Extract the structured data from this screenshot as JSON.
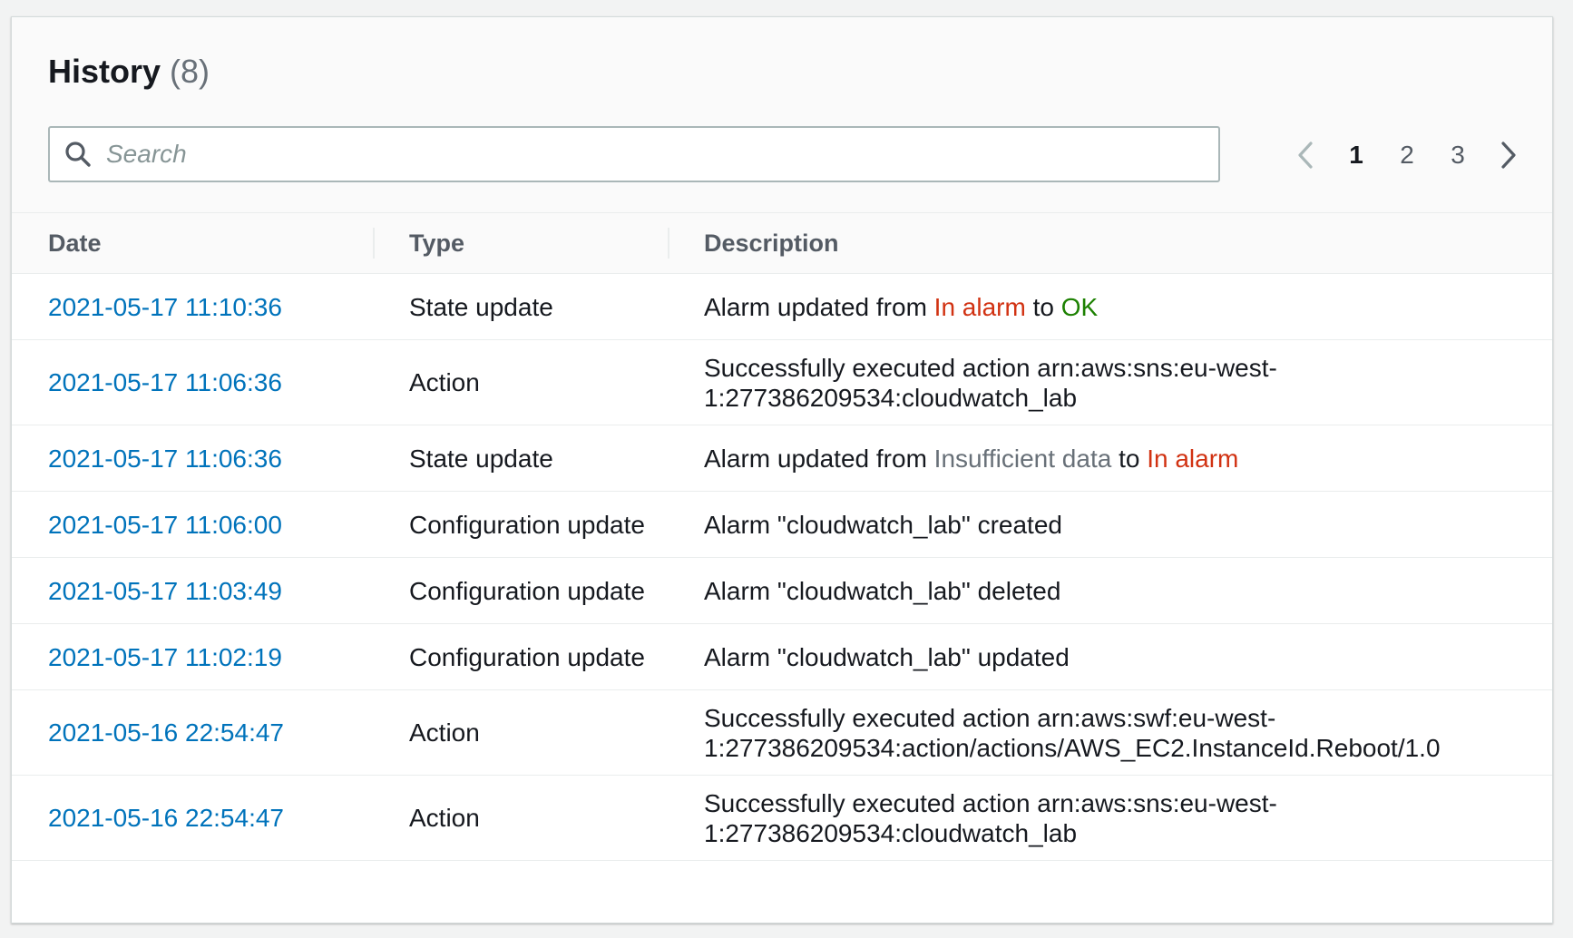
{
  "header": {
    "title": "History",
    "count": "(8)"
  },
  "search": {
    "placeholder": "Search",
    "value": ""
  },
  "pagination": {
    "pages": [
      "1",
      "2",
      "3"
    ],
    "current": "1"
  },
  "table": {
    "columns": [
      "Date",
      "Type",
      "Description"
    ],
    "rows": [
      {
        "date": "2021-05-17 11:10:36",
        "type": "State update",
        "desc_prefix": "Alarm updated from ",
        "from_state": "In alarm",
        "mid": " to ",
        "to_state": "OK"
      },
      {
        "date": "2021-05-17 11:06:36",
        "type": "Action",
        "desc_line1": "Successfully executed action arn:aws:sns:eu-west-",
        "desc_line2": "1:277386209534:cloudwatch_lab"
      },
      {
        "date": "2021-05-17 11:06:36",
        "type": "State update",
        "desc_prefix": "Alarm updated from ",
        "from_state": "Insufficient data",
        "mid": " to ",
        "to_state": "In alarm"
      },
      {
        "date": "2021-05-17 11:06:00",
        "type": "Configuration update",
        "description": "Alarm \"cloudwatch_lab\" created"
      },
      {
        "date": "2021-05-17 11:03:49",
        "type": "Configuration update",
        "description": "Alarm \"cloudwatch_lab\" deleted"
      },
      {
        "date": "2021-05-17 11:02:19",
        "type": "Configuration update",
        "description": "Alarm \"cloudwatch_lab\" updated"
      },
      {
        "date": "2021-05-16 22:54:47",
        "type": "Action",
        "desc_line1": "Successfully executed action arn:aws:swf:eu-west-",
        "desc_line2": "1:277386209534:action/actions/AWS_EC2.InstanceId.Reboot/1.0"
      },
      {
        "date": "2021-05-16 22:54:47",
        "type": "Action",
        "desc_line1": "Successfully executed action arn:aws:sns:eu-west-",
        "desc_line2": "1:277386209534:cloudwatch_lab"
      }
    ]
  },
  "colors": {
    "link": "#0073bb",
    "alarm": "#d13212",
    "ok": "#1d8102",
    "insufficient": "#687078"
  },
  "icons": {
    "search": "search-icon",
    "prev": "chevron-left-icon",
    "next": "chevron-right-icon"
  }
}
